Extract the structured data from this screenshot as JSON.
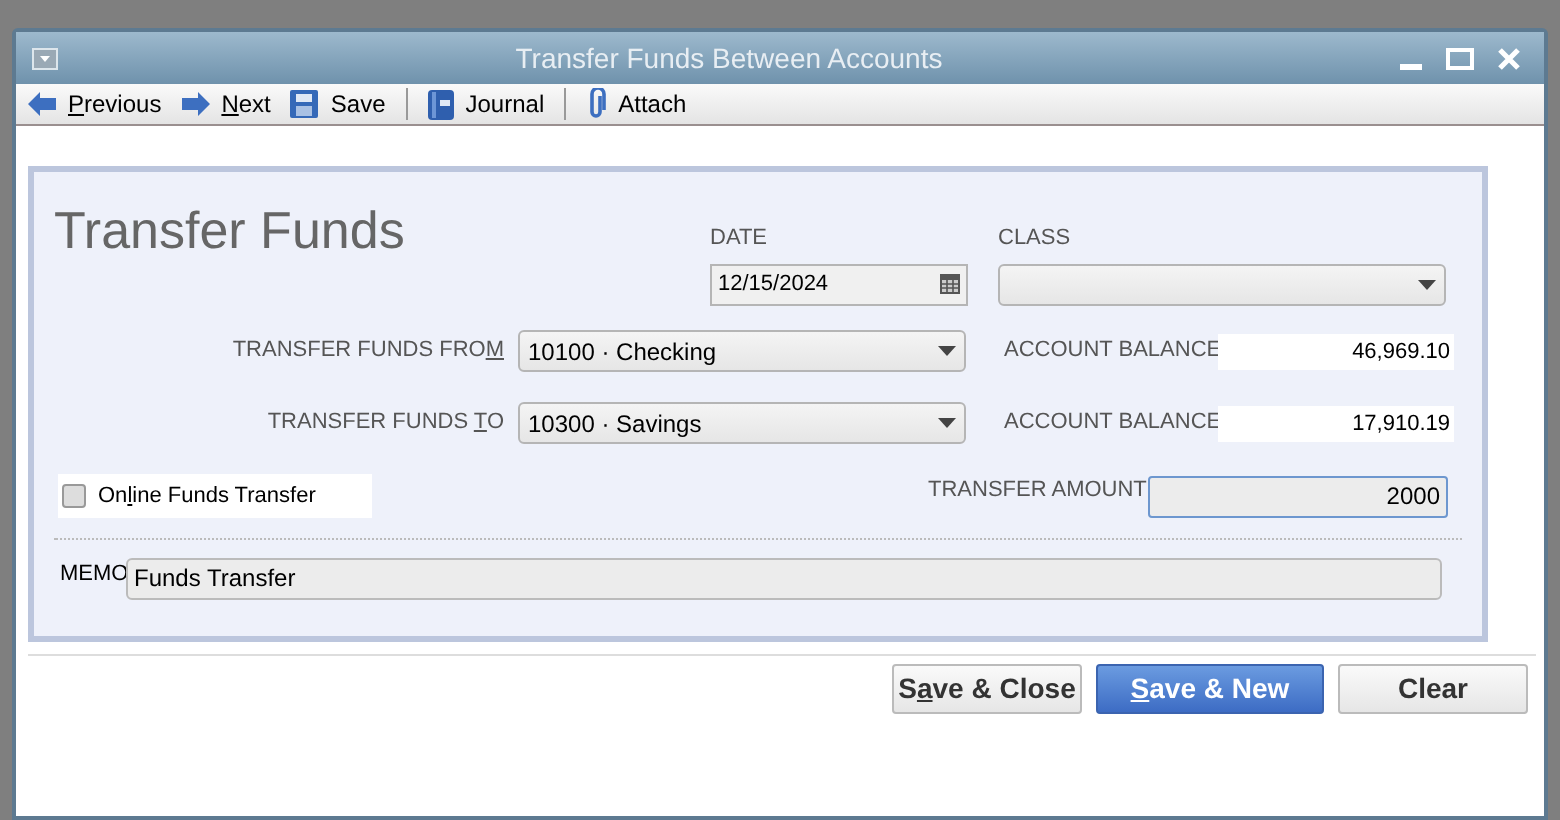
{
  "window": {
    "title": "Transfer Funds Between Accounts"
  },
  "toolbar": [
    {
      "underlined": "P",
      "after": "revious",
      "kind": "prev"
    },
    {
      "underlined": "N",
      "after": "ext",
      "kind": "next"
    },
    {
      "after": "Save",
      "kind": "save"
    },
    {
      "after": "Journal",
      "kind": "journal"
    },
    {
      "after": "Attach",
      "kind": "attach"
    }
  ],
  "form": {
    "heading": "Transfer Funds",
    "date": {
      "label": "DATE",
      "value": "12/15/2024"
    },
    "class": {
      "label": "CLASS"
    },
    "from": {
      "label": {
        "before": "TRANSFER FUNDS FRO",
        "underlined": "M"
      },
      "value": "10100 · Checking",
      "balance_label": "ACCOUNT BALANCE",
      "balance": "46,969.10"
    },
    "to": {
      "label": {
        "before": "TRANSFER FUNDS ",
        "underlined": "T",
        "after": "O"
      },
      "value": "10300 · Savings",
      "balance_label": "ACCOUNT BALANCE",
      "balance": "17,910.19"
    },
    "online": {
      "label": {
        "before": "On",
        "underlined": "l",
        "after": "ine Funds Transfer"
      },
      "checked": false
    },
    "amount": {
      "label": "TRANSFER AMOUNT",
      "value": "2000"
    },
    "memo": {
      "label": "MEMO",
      "value": "Funds Transfer"
    }
  },
  "buttons": [
    {
      "before": "S",
      "underlined": "a",
      "after": "ve & Close",
      "primary": false
    },
    {
      "underlined": "S",
      "after": "ave & New",
      "primary": true
    },
    {
      "after": "Clear",
      "primary": false
    }
  ]
}
